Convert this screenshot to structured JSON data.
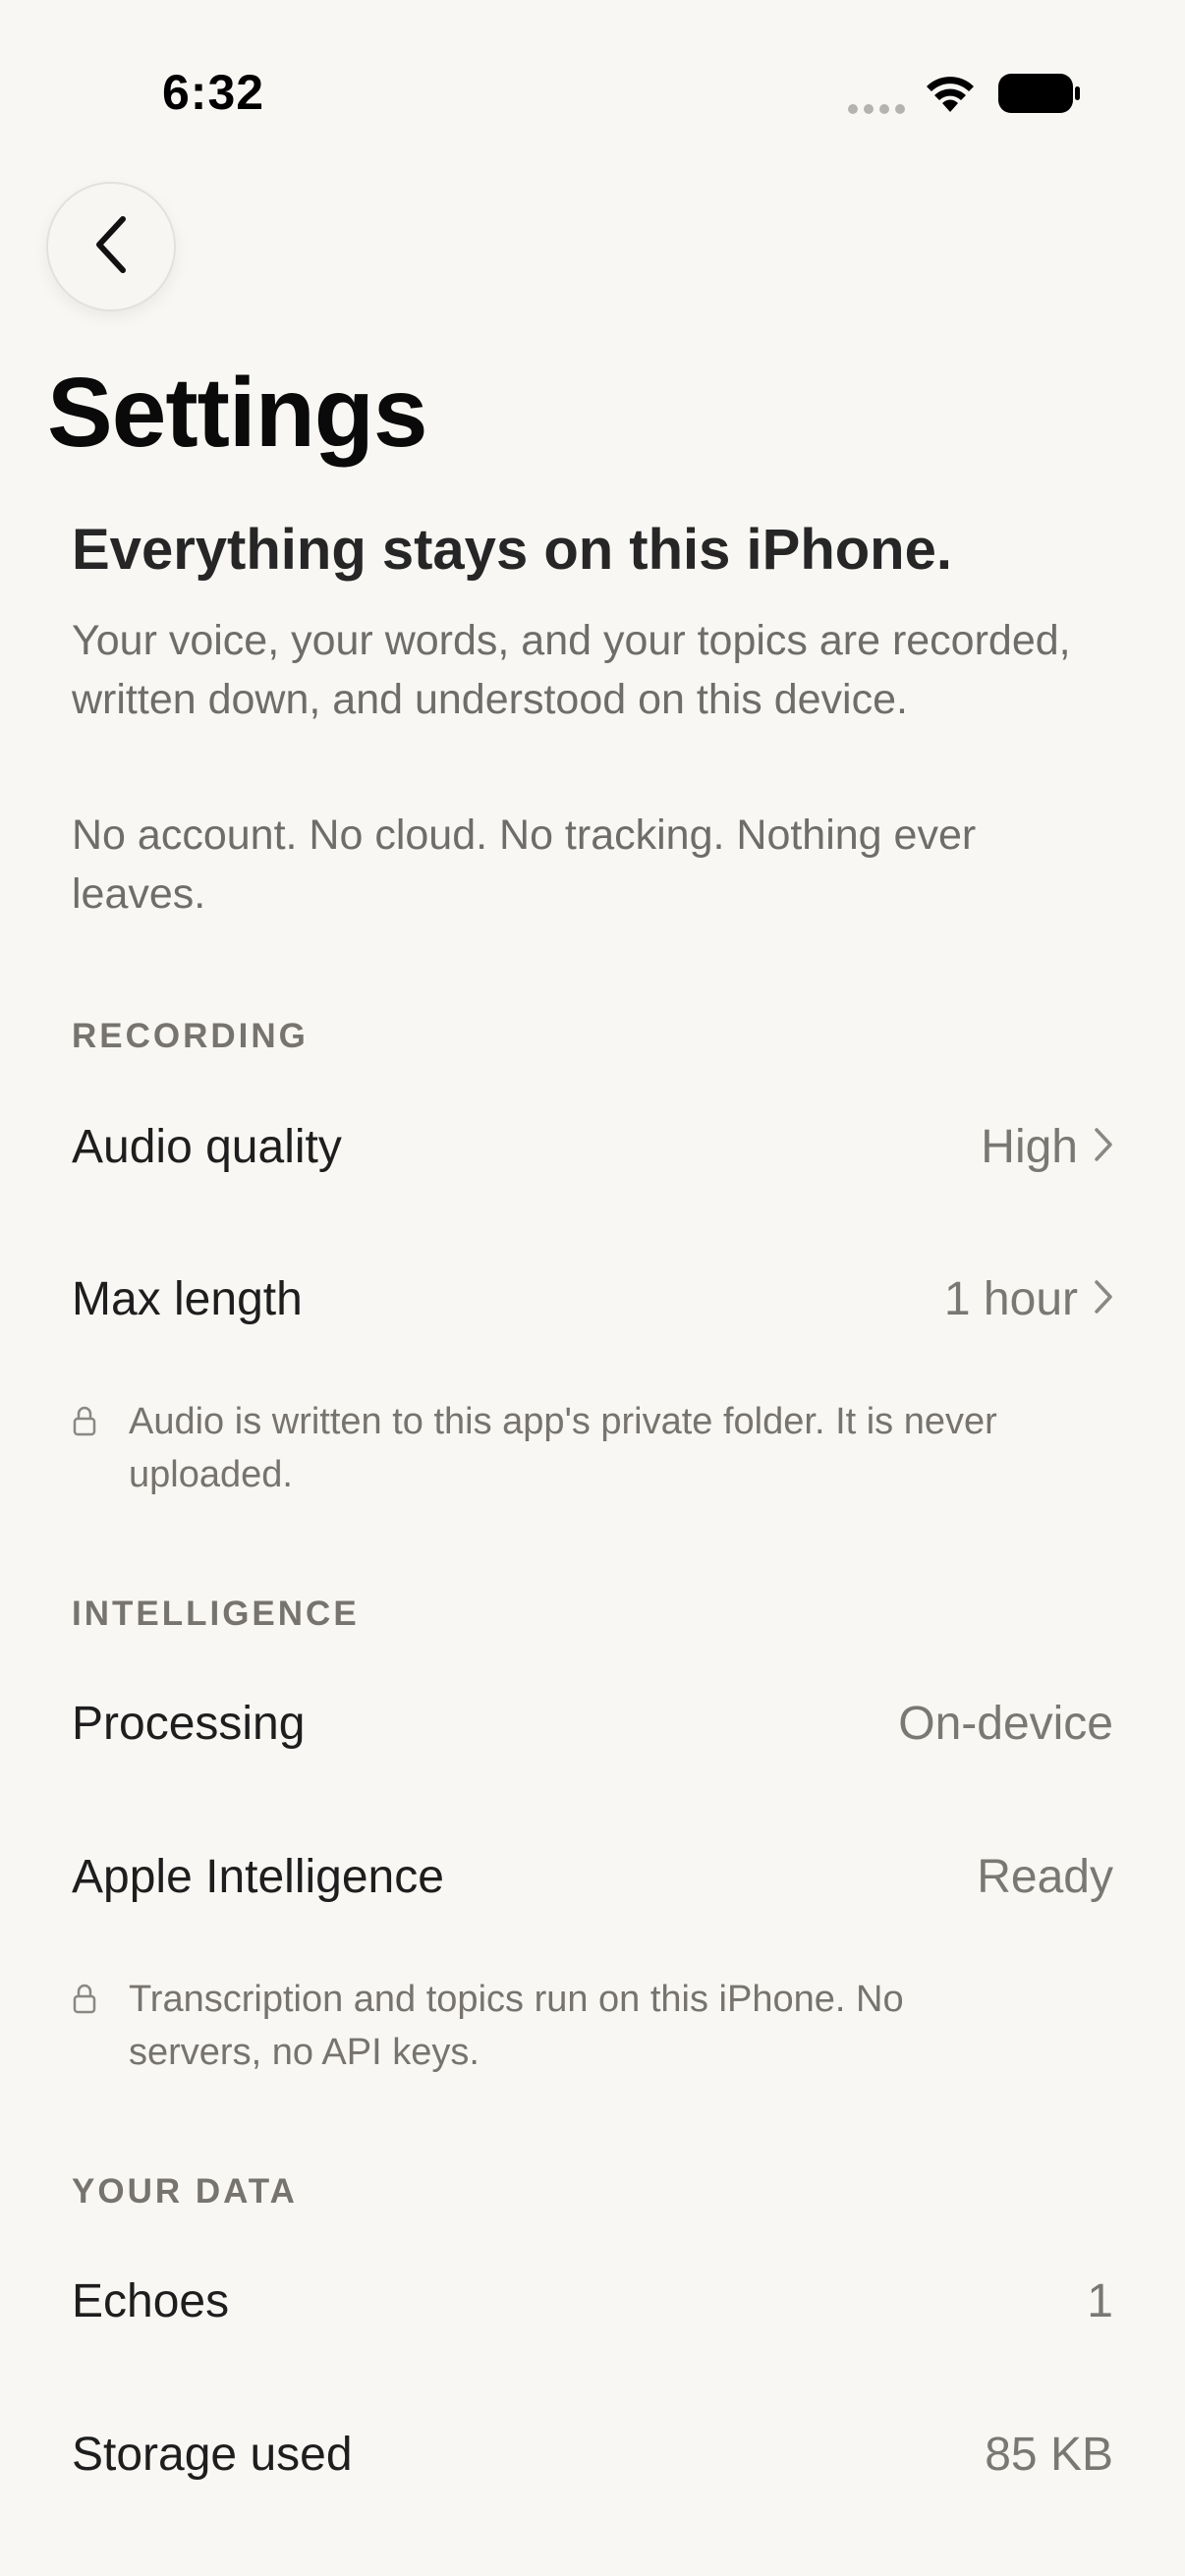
{
  "status_bar": {
    "time": "6:32",
    "icons": [
      "signal-icon",
      "wifi-icon",
      "battery-icon"
    ]
  },
  "nav": {
    "back_icon": "chevron-left-icon"
  },
  "title": "Settings",
  "privacy": {
    "heading": "Everything stays on this iPhone.",
    "body": "Your voice, your words, and your topics are recorded, written down, and understood on this device.",
    "body2": "No account. No cloud. No tracking. Nothing ever leaves."
  },
  "sections": {
    "recording": {
      "header": "RECORDING",
      "rows": [
        {
          "label": "Audio quality",
          "value": "High"
        },
        {
          "label": "Max length",
          "value": "1 hour"
        }
      ],
      "note": "Audio is written to this app's private folder. It is never uploaded."
    },
    "intelligence": {
      "header": "INTELLIGENCE",
      "rows": [
        {
          "label": "Processing",
          "value": "On-device"
        },
        {
          "label": "Apple Intelligence",
          "value": "Ready"
        }
      ],
      "note": "Transcription and topics run on this iPhone. No servers, no API keys."
    },
    "your_data": {
      "header": "YOUR DATA",
      "rows": [
        {
          "label": "Echoes",
          "value": "1"
        },
        {
          "label": "Storage used",
          "value": "85 KB"
        }
      ]
    }
  },
  "colors": {
    "background": "#f8f7f4",
    "primary_text": "#1e1e1e",
    "secondary_text": "#7a7873"
  }
}
